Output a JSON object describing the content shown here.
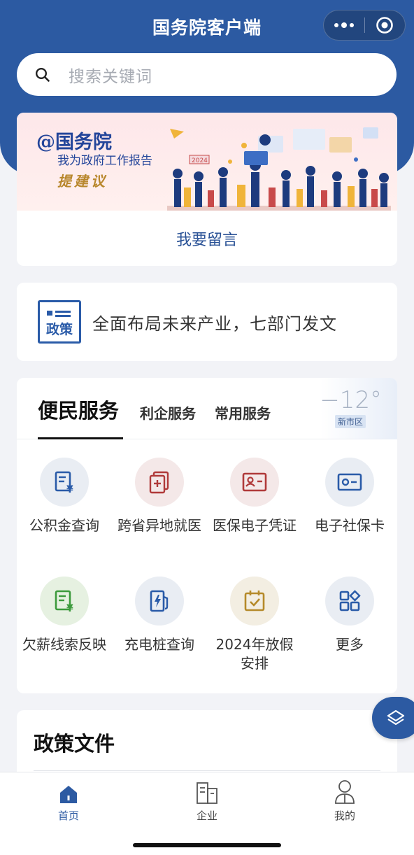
{
  "app": {
    "title": "国务院客户端"
  },
  "capsule": {
    "more_icon": "more-dots-icon",
    "close_icon": "target-icon"
  },
  "search": {
    "placeholder": "搜索关键词",
    "icon": "search-icon"
  },
  "banner": {
    "line1": "@国务院",
    "line2": "我为政府工作报告",
    "line3": "提建议",
    "year_tag": "2024",
    "action": "我要留言"
  },
  "news": {
    "icon_label": "政策",
    "text": "全面布局未来产业，七部门发文"
  },
  "services": {
    "tabs": [
      {
        "label": "便民服务",
        "active": true
      },
      {
        "label": "利企服务",
        "active": false
      },
      {
        "label": "常用服务",
        "active": false
      }
    ],
    "weather": {
      "temp": "−12°",
      "location": "新市区"
    },
    "items": [
      {
        "label": "公积金查询",
        "icon": "fund-receipt-icon",
        "bg": "#e9edf3",
        "color": "#2a5ba8"
      },
      {
        "label": "跨省异地就医",
        "icon": "medical-doc-icon",
        "bg": "#f4e8e8",
        "color": "#b03a3a"
      },
      {
        "label": "医保电子凭证",
        "icon": "id-card-icon",
        "bg": "#f4e8e8",
        "color": "#b03a3a"
      },
      {
        "label": "电子社保卡",
        "icon": "social-card-icon",
        "bg": "#e9edf3",
        "color": "#2a5ba8"
      },
      {
        "label": "欠薪线索反映",
        "icon": "wage-receipt-icon",
        "bg": "#e6f1e1",
        "color": "#3c9a3c"
      },
      {
        "label": "充电桩查询",
        "icon": "charging-pile-icon",
        "bg": "#e9edf3",
        "color": "#2a5ba8"
      },
      {
        "label": "2024年放假安排",
        "icon": "calendar-check-icon",
        "bg": "#f3eee2",
        "color": "#b58a2a"
      },
      {
        "label": "更多",
        "icon": "grid-more-icon",
        "bg": "#e9edf3",
        "color": "#2a5ba8"
      }
    ]
  },
  "policy": {
    "title": "政策文件"
  },
  "float_button": {
    "icon": "layers-icon"
  },
  "tabbar": {
    "items": [
      {
        "label": "首页",
        "icon": "home-icon",
        "active": true
      },
      {
        "label": "企业",
        "icon": "building-icon",
        "active": false
      },
      {
        "label": "我的",
        "icon": "user-icon",
        "active": false
      }
    ]
  },
  "colors": {
    "brand": "#2c5aa2",
    "accent_gold": "#b8872c"
  }
}
